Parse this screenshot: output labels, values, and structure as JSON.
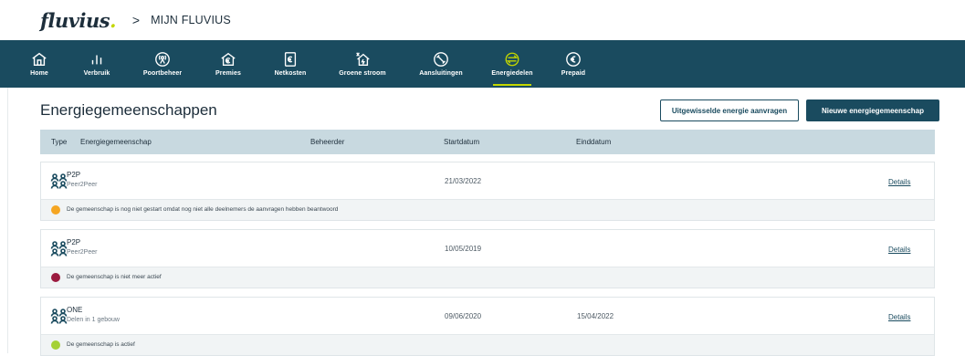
{
  "header": {
    "logo": "fluvius",
    "logo_dot": ".",
    "breadcrumb_sep": ">",
    "breadcrumb": "MIJN FLUVIUS"
  },
  "nav": {
    "items": [
      {
        "label": "Home",
        "icon": "home-icon"
      },
      {
        "label": "Verbruik",
        "icon": "bar-chart-icon"
      },
      {
        "label": "Poortbeheer",
        "icon": "antenna-icon"
      },
      {
        "label": "Premies",
        "icon": "euro-house-icon"
      },
      {
        "label": "Netkosten",
        "icon": "euro-document-icon"
      },
      {
        "label": "Groene stroom",
        "icon": "green-energy-house-icon"
      },
      {
        "label": "Aansluitingen",
        "icon": "plug-icon"
      },
      {
        "label": "Energiedelen",
        "icon": "energy-sharing-icon"
      },
      {
        "label": "Prepaid",
        "icon": "euro-circle-icon"
      }
    ],
    "active": "Energiedelen",
    "accent": "#c3d600",
    "background": "#1a4b5f"
  },
  "page": {
    "title": "Energiegemeenschappen",
    "btn_request": "Uitgewisselde energie aanvragen",
    "btn_new": "Nieuwe energiegemeenschap"
  },
  "table": {
    "headers": {
      "type": "Type",
      "community": "Energiegemeenschap",
      "manager": "Beheerder",
      "start": "Startdatum",
      "end": "Einddatum"
    },
    "rows": [
      {
        "name": "P2P",
        "subtitle": "Peer2Peer",
        "start": "21/03/2022",
        "end": "",
        "details": "Details",
        "status_text": "De gemeenschap is nog niet gestart omdat nog niet alle deelnemers de aanvragen hebben beantwoord",
        "status_color": "#f5a623"
      },
      {
        "name": "P2P",
        "subtitle": "Peer2Peer",
        "start": "10/05/2019",
        "end": "",
        "details": "Details",
        "status_text": "De gemeenschap is niet meer actief",
        "status_color": "#9b1b3f"
      },
      {
        "name": "ONE",
        "subtitle": "Delen in 1 gebouw",
        "start": "09/06/2020",
        "end": "15/04/2022",
        "details": "Details",
        "status_text": "De gemeenschap is actief",
        "status_color": "#a5d136"
      }
    ]
  }
}
